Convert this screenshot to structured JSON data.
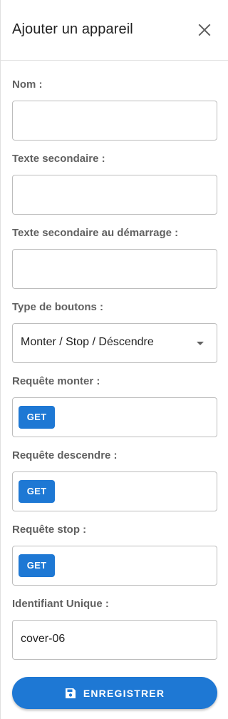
{
  "dialog": {
    "title": "Ajouter un appareil",
    "close_icon": "close-icon"
  },
  "form": {
    "name": {
      "label": "Nom :",
      "value": ""
    },
    "secondary_text": {
      "label": "Texte secondaire :",
      "value": ""
    },
    "secondary_text_startup": {
      "label": "Texte secondaire au démarrage :",
      "value": ""
    },
    "button_type": {
      "label": "Type de boutons :",
      "value": "Monter / Stop / Déscendre"
    },
    "request_up": {
      "label": "Requête monter :",
      "method": "GET"
    },
    "request_down": {
      "label": "Requête descendre :",
      "method": "GET"
    },
    "request_stop": {
      "label": "Requête stop :",
      "method": "GET"
    },
    "unique_id": {
      "label": "Identifiant Unique :",
      "value": "cover-06"
    }
  },
  "actions": {
    "save_label": "ENREGISTRER",
    "save_icon": "floppy-disk-icon"
  },
  "colors": {
    "primary": "#1e78d4",
    "label": "#616161",
    "border": "#bdbdbd"
  }
}
